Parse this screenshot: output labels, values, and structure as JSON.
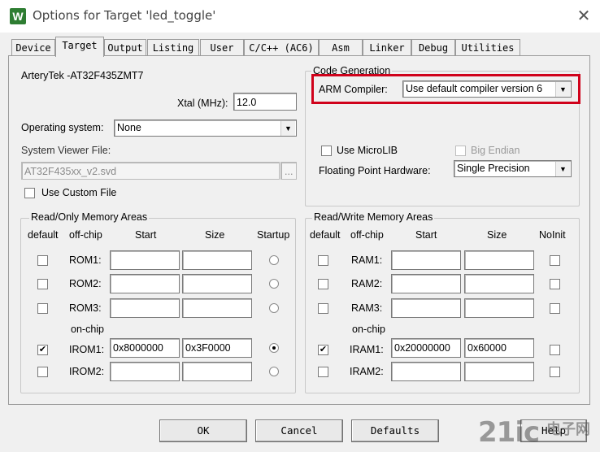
{
  "window": {
    "title": "Options for Target 'led_toggle'",
    "close": "✕",
    "icon": "W"
  },
  "tabs": [
    "Device",
    "Target",
    "Output",
    "Listing",
    "User",
    "C/C++ (AC6)",
    "Asm",
    "Linker",
    "Debug",
    "Utilities"
  ],
  "target": {
    "device_name": "ArteryTek -AT32F435ZMT7",
    "xtal_label": "Xtal (MHz):",
    "xtal_value": "12.0",
    "os_label": "Operating system:",
    "os_value": "None",
    "svd_label": "System Viewer File:",
    "svd_value": "AT32F435xx_v2.svd",
    "browse": "...",
    "custom_file_label": "Use Custom File"
  },
  "code_gen": {
    "title": "Code Generation",
    "compiler_label": "ARM Compiler:",
    "compiler_value": "Use default compiler version 6",
    "microlib_label": "Use MicroLIB",
    "big_endian_label": "Big Endian",
    "fph_label": "Floating Point Hardware:",
    "fph_value": "Single Precision"
  },
  "ro_memory": {
    "title": "Read/Only Memory Areas",
    "headers": {
      "default": "default",
      "offchip": "off-chip",
      "start": "Start",
      "size": "Size",
      "startup": "Startup"
    },
    "onchip_label": "on-chip",
    "rows": [
      {
        "name": "ROM1:",
        "start": "",
        "size": "",
        "default": false,
        "startup": false
      },
      {
        "name": "ROM2:",
        "start": "",
        "size": "",
        "default": false,
        "startup": false
      },
      {
        "name": "ROM3:",
        "start": "",
        "size": "",
        "default": false,
        "startup": false
      },
      {
        "name": "IROM1:",
        "start": "0x8000000",
        "size": "0x3F0000",
        "default": true,
        "startup": true
      },
      {
        "name": "IROM2:",
        "start": "",
        "size": "",
        "default": false,
        "startup": false
      }
    ]
  },
  "rw_memory": {
    "title": "Read/Write Memory Areas",
    "headers": {
      "default": "default",
      "offchip": "off-chip",
      "start": "Start",
      "size": "Size",
      "noinit": "NoInit"
    },
    "onchip_label": "on-chip",
    "rows": [
      {
        "name": "RAM1:",
        "start": "",
        "size": "",
        "default": false,
        "noinit": false
      },
      {
        "name": "RAM2:",
        "start": "",
        "size": "",
        "default": false,
        "noinit": false
      },
      {
        "name": "RAM3:",
        "start": "",
        "size": "",
        "default": false,
        "noinit": false
      },
      {
        "name": "IRAM1:",
        "start": "0x20000000",
        "size": "0x60000",
        "default": true,
        "noinit": false
      },
      {
        "name": "IRAM2:",
        "start": "",
        "size": "",
        "default": false,
        "noinit": false
      }
    ]
  },
  "buttons": {
    "ok": "OK",
    "cancel": "Cancel",
    "defaults": "Defaults",
    "help": "Help"
  },
  "watermark": {
    "brand": "21ic",
    "cn": "电子网"
  },
  "check_mark": "✔",
  "dropdown_arrow": "▼",
  "colors": {
    "highlight": "#d0021b"
  }
}
